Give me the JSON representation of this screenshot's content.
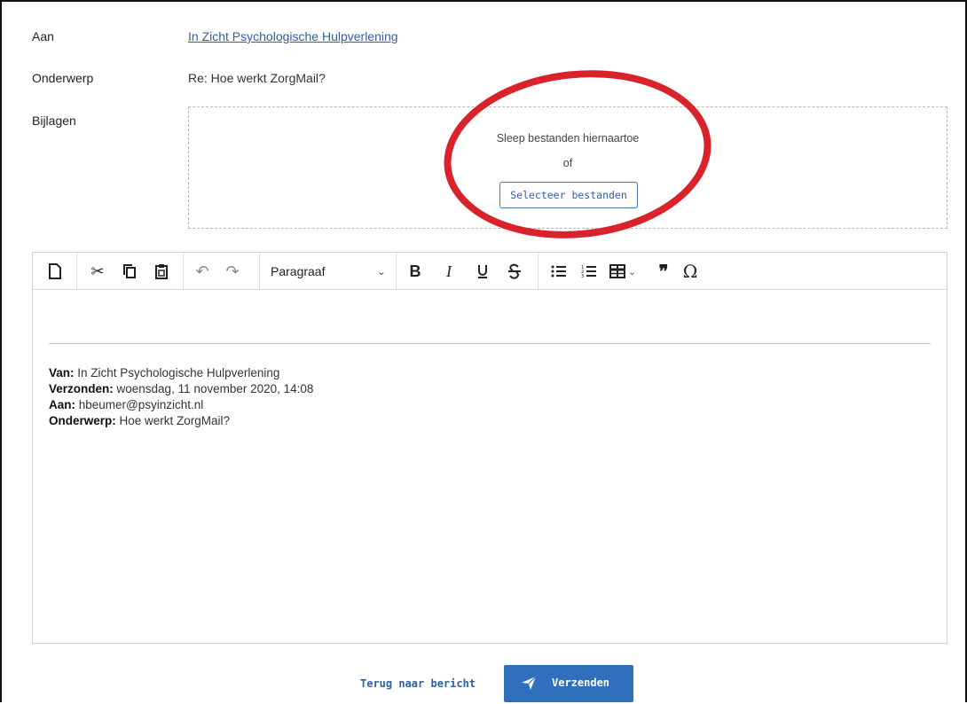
{
  "form": {
    "to_label": "Aan",
    "to_value": "In Zicht Psychologische Hulpverlening",
    "subject_label": "Onderwerp",
    "subject_value": "Re: Hoe werkt ZorgMail?",
    "attachments_label": "Bijlagen",
    "dropzone": {
      "drag_text": "Sleep bestanden hiernaartoe",
      "or_text": "of",
      "select_button": "Selecteer bestanden"
    }
  },
  "toolbar": {
    "icons": [
      "new-document-icon",
      "cut-icon",
      "copy-icon",
      "paste-icon",
      "undo-icon",
      "redo-icon",
      "bold-icon",
      "italic-icon",
      "underline-icon",
      "strikethrough-icon",
      "bullet-list-icon",
      "numbered-list-icon",
      "table-icon",
      "blockquote-icon",
      "special-character-icon"
    ],
    "block_format": "Paragraaf"
  },
  "quoted": {
    "from_label": "Van:",
    "from_value": " In Zicht Psychologische Hulpverlening",
    "sent_label": "Verzonden:",
    "sent_value": " woensdag, 11 november 2020, 14:08",
    "to_label": "Aan:",
    "to_value": " hbeumer@psyinzicht.nl",
    "subject_label": "Onderwerp:",
    "subject_value": " Hoe werkt ZorgMail?"
  },
  "footer": {
    "back_label": "Terug naar bericht",
    "send_label": "Verzenden"
  },
  "colors": {
    "link": "#2f5fa5",
    "primary_button": "#2f6fbb",
    "annotation": "#d9222a"
  }
}
